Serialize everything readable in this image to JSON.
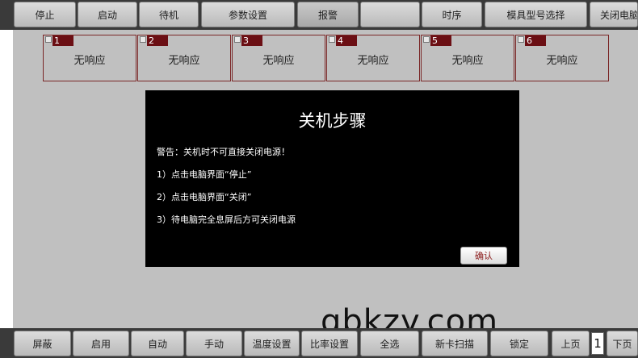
{
  "top_toolbar": {
    "buttons": [
      "停止",
      "启动",
      "待机",
      "参数设置",
      "报警",
      "",
      "时序",
      "模具型号选择",
      "关闭电脑"
    ]
  },
  "stations": [
    {
      "number": "1",
      "status": "无响应"
    },
    {
      "number": "2",
      "status": "无响应"
    },
    {
      "number": "3",
      "status": "无响应"
    },
    {
      "number": "4",
      "status": "无响应"
    },
    {
      "number": "5",
      "status": "无响应"
    },
    {
      "number": "6",
      "status": "无响应"
    }
  ],
  "dialog": {
    "title": "关机步骤",
    "warning": "警告：关机时不可直接关闭电源！",
    "steps": [
      "1）点击电脑界面“停止”",
      "2）点击电脑界面“关闭”",
      "3）待电脑完全息屏后方可关闭电源"
    ],
    "confirm_label": "确认"
  },
  "watermark": "gbkzy.com",
  "bottom_toolbar": {
    "buttons": [
      "屏蔽",
      "启用",
      "自动",
      "手动",
      "温度设置",
      "比率设置",
      "全选",
      "新卡扫描",
      "锁定"
    ],
    "prev_page": "上页",
    "page_number": "1",
    "next_page": "下页"
  },
  "colors": {
    "background": "#c0c0c0",
    "toolbar": "#3a3a3a",
    "tile_border": "#7a2626",
    "tile_number": "#6b0f14",
    "dialog_background": "#000000",
    "confirm_text": "#8b1a1a"
  }
}
